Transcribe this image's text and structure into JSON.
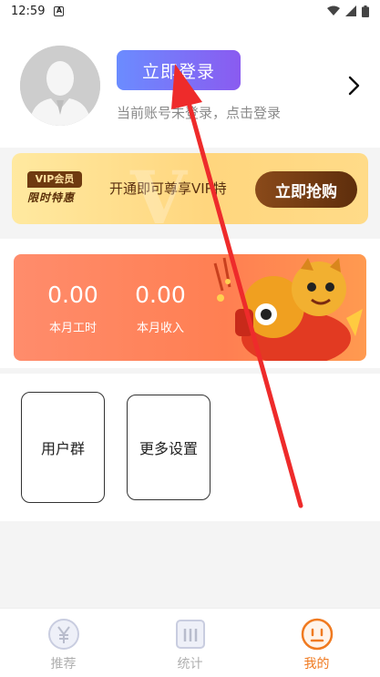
{
  "status_bar": {
    "time": "12:59",
    "notification_glyph": "A"
  },
  "profile": {
    "login_button_label": "立即登录",
    "login_hint": "当前账号未登录，点击登录"
  },
  "vip": {
    "badge_top": "VIP会员",
    "badge_bottom": "限时特惠",
    "promo_text": "开通即可尊享VIP特",
    "buy_label": "立即抢购"
  },
  "stats": {
    "hours_value": "0.00",
    "hours_label": "本月工时",
    "income_value": "0.00",
    "income_label": "本月收入"
  },
  "actions": {
    "group_label": "用户群",
    "settings_label": "更多设置"
  },
  "nav": {
    "items": [
      {
        "label": "推荐",
        "icon": "yen-icon"
      },
      {
        "label": "统计",
        "icon": "stats-icon"
      },
      {
        "label": "我的",
        "icon": "face-icon",
        "active": true
      }
    ]
  },
  "colors": {
    "login_gradient_start": "#6b8cff",
    "login_gradient_end": "#8a5bf0",
    "accent": "#f07a20",
    "annotation_arrow": "#ee2b2b"
  }
}
